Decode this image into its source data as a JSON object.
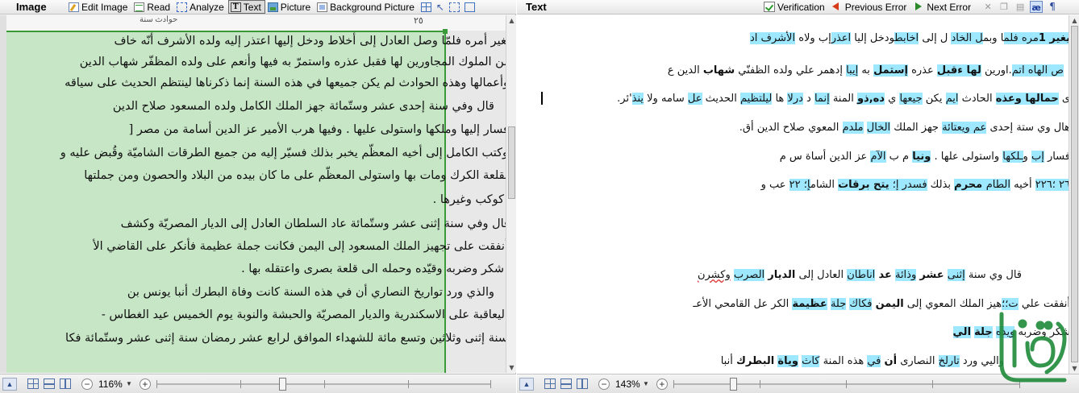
{
  "left_panel": {
    "title": "Image",
    "toolbar": {
      "edit_image": "Edit Image",
      "read": "Read",
      "analyze": "Analyze",
      "text": "Text",
      "picture": "Picture",
      "background_picture": "Background Picture"
    },
    "page_header_text": "حوادث سنة",
    "page_number": "٢٥",
    "lines": [
      "بغير أمره فلمّا وصل العادل إلى أخلاط ودخل إليها اعتذر إليه ولده الأشرف أنّه خاف",
      "من الملوك المجاورين لها فقبل عذره واستمرّ به فيها وأنعم على ولده المظفّر شهاب الدين",
      "وأعمالها وهذه الحوادث لم يكن جميعها في هذه السنة إنما ذكرناها لينتظم الحديث على سياقه",
      "قال وفي سنة إحدى عشر وستّمائة جهز الملك الكامل ولده المسعود صلاح الدين",
      "فسار إليها وملكها واستولى عليها . وفيها هرب الأمير عز الدين أسامة من مصر [",
      "وكتب الكامل إلى أخيه المعظّم يخبر بذلك فسيّر إليه من جميع الطرقات الشاميّة وقُبض عليه و",
      "بقلعة الكرك ومات بها واستولى المعظّم على ما كان بيده من البلاد والحصون ومن جملتها",
      "كوكب وغيرها .",
      "قال وفي سنة إثنى عشر وستّمائة عاد السلطان العادل إلى الديار المصريّة وكشف",
      "أنفقت على تجهيز الملك المسعود إلى اليمن فكانت جملة عظيمة فأنكر على القاضي الأ",
      "شكر وضربه وقيّده وحمله الى قلعة بصرى واعتقله بها .",
      "والذي ورد تواريخ النصاري أن في هذه السنة كانت وفاة البطرك أنبا يونس بن",
      "اليعاقبة على الاسكندرية والديار المصريّة والحبشة والنوبة يوم الخميس عيد الغطاس -",
      "سنة إثنى وثلاثين وتسع مائة للشهداء الموافق لرابع عشر رمضان سنة إثنى عشر وستّمائة فكا"
    ],
    "zoom": "116%"
  },
  "right_panel": {
    "title": "Text",
    "toolbar": {
      "verification": "Verification",
      "previous_error": "Previous Error",
      "next_error": "Next Error"
    },
    "zoom": "143%",
    "lines": [
      [
        {
          "t": "يغير ",
          "hl": true,
          "b": true
        },
        {
          "t": "1",
          "hl": true,
          "b": true
        },
        {
          "t": "مره ",
          "hl": true
        },
        {
          "t": "فلم",
          "hl": true
        },
        {
          "t": "ا وبم",
          "hl": false
        },
        {
          "t": "ل ",
          "hl": true
        },
        {
          "t": "الخاد",
          "hl": true
        },
        {
          "t": " ل إلى ",
          "hl": false
        },
        {
          "t": "اخابط",
          "hl": true
        },
        {
          "t": "ودخل إليا ",
          "hl": false
        },
        {
          "t": "اعذر",
          "hl": true
        },
        {
          "t": "إب ولاه ",
          "hl": false
        },
        {
          "t": "الأشرف اد",
          "hl": true
        }
      ],
      [
        {
          "t": "ص ",
          "hl": true
        },
        {
          "t": "الهاه",
          "hl": true
        },
        {
          "t": " اتم",
          "hl": true
        },
        {
          "t": ".اورين ",
          "hl": false
        },
        {
          "t": "لها ",
          "hl": true,
          "b": true
        },
        {
          "t": "ءقبل",
          "hl": true,
          "b": true
        },
        {
          "t": " عذره ",
          "hl": false
        },
        {
          "t": "إستمل",
          "hl": true,
          "b": true
        },
        {
          "t": " به ",
          "hl": false
        },
        {
          "t": "إيبا",
          "hl": true
        },
        {
          "t": " إدهمر علي ولده الظفنّي ",
          "hl": false
        },
        {
          "t": "شهاب",
          "hl": false,
          "b": true
        },
        {
          "t": " الدين ع",
          "hl": false
        }
      ],
      [
        {
          "t": "ى ",
          "hl": false
        },
        {
          "t": "حمالها",
          "hl": true,
          "b": true
        },
        {
          "t": " وعذه",
          "hl": true,
          "b": true
        },
        {
          "t": " الحادث ",
          "hl": false
        },
        {
          "t": "ايم",
          "hl": true
        },
        {
          "t": " يكن ",
          "hl": false
        },
        {
          "t": "جيعها",
          "hl": true
        },
        {
          "t": " ي ",
          "hl": false
        },
        {
          "t": "ده,ذو",
          "hl": true,
          "b": true
        },
        {
          "t": " المنة ",
          "hl": false
        },
        {
          "t": "إنما",
          "hl": true
        },
        {
          "t": " د ",
          "hl": false
        },
        {
          "t": "درلا",
          "hl": true
        },
        {
          "t": " ها ",
          "hl": false
        },
        {
          "t": "ليلت",
          "hl": true
        },
        {
          "t": "ظيم",
          "hl": true
        },
        {
          "t": " الحديث ",
          "hl": false
        },
        {
          "t": "عل",
          "hl": true
        },
        {
          "t": " سامه ولا ",
          "hl": false
        },
        {
          "t": "ينذ",
          "hl": true
        },
        {
          "t": "'ئر.",
          "hl": false
        }
      ],
      [
        {
          "t": "هال وي ستة إحدى ",
          "hl": false
        },
        {
          "t": "عم",
          "hl": true
        },
        {
          "t": " ويعتائة",
          "hl": true
        },
        {
          "t": " جهز الملك ",
          "hl": false
        },
        {
          "t": "الخال",
          "hl": true
        },
        {
          "t": " ",
          "hl": false
        },
        {
          "t": "ملدم",
          "hl": true
        },
        {
          "t": " المعوي صلاح الدين أق.",
          "hl": false
        }
      ],
      [
        {
          "t": "فسار ",
          "hl": false
        },
        {
          "t": "إب",
          "hl": true
        },
        {
          "t": " و",
          "hl": false
        },
        {
          "t": "ـلكها",
          "hl": true
        },
        {
          "t": " واستولى علها . ",
          "hl": false
        },
        {
          "t": "ونيا",
          "hl": true,
          "b": true
        },
        {
          "t": " م ب ",
          "hl": false
        },
        {
          "t": "الآم",
          "hl": true
        },
        {
          "t": " عز الدين أساة س م",
          "hl": false
        }
      ],
      [
        {
          "t": "٢٦ ",
          "hl": true
        },
        {
          "t": "؛٢٢٦",
          "hl": true
        },
        {
          "t": " أخيه ",
          "hl": false
        },
        {
          "t": "الطام",
          "hl": true
        },
        {
          "t": " محرم",
          "hl": true,
          "b": true
        },
        {
          "t": " بذلك ",
          "hl": false
        },
        {
          "t": "فسدر",
          "hl": true
        },
        {
          "t": " إ؛ ",
          "hl": true
        },
        {
          "t": "يتح",
          "hl": true,
          "b": true
        },
        {
          "t": " برقات",
          "hl": true,
          "b": true
        },
        {
          "t": " الشام",
          "hl": false
        },
        {
          "t": "إ؛ ",
          "hl": true
        },
        {
          "t": "٢٢",
          "hl": true
        },
        {
          "t": " عب و",
          "hl": false
        }
      ],
      [
        {
          "t": "قال وي سنة ",
          "hl": false
        },
        {
          "t": "إثنى",
          "hl": true
        },
        {
          "t": " ",
          "hl": false
        },
        {
          "t": "عشر",
          "hl": false,
          "b": true
        },
        {
          "t": " ",
          "hl": false
        },
        {
          "t": "وذائة",
          "hl": true
        },
        {
          "t": " ",
          "hl": false
        },
        {
          "t": "عد",
          "hl": false,
          "b": true
        },
        {
          "t": " ",
          "hl": false
        },
        {
          "t": "اناطان",
          "hl": true
        },
        {
          "t": " العادل إلى ",
          "hl": false
        },
        {
          "t": "الديار",
          "hl": false,
          "b": true
        },
        {
          "t": " ",
          "hl": false
        },
        {
          "t": "الصرب",
          "hl": true
        },
        {
          "t": " ",
          "hl": false
        },
        {
          "t": "وكشرن",
          "hl": false,
          "ul": true
        }
      ],
      [
        {
          "t": "أنفقت علي ",
          "hl": false
        },
        {
          "t": "ت؛؛",
          "hl": true
        },
        {
          "t": "هيز الملك المعوي إلى ",
          "hl": false
        },
        {
          "t": "اليمن",
          "hl": false,
          "b": true
        },
        {
          "t": " ",
          "hl": false
        },
        {
          "t": "فكاك",
          "hl": true
        },
        {
          "t": " ",
          "hl": false
        },
        {
          "t": "جلة",
          "hl": true
        },
        {
          "t": " ",
          "hl": false
        },
        {
          "t": "عظيمة",
          "hl": true,
          "b": true
        },
        {
          "t": " الكر عل القامحي الأعـ",
          "hl": false
        }
      ],
      [
        {
          "t": "شكر وضربه ",
          "hl": false
        },
        {
          "t": "ويده",
          "hl": true
        },
        {
          "t": " ",
          "hl": false
        },
        {
          "t": "جلة",
          "hl": true,
          "b": true
        },
        {
          "t": " ",
          "hl": false
        },
        {
          "t": "الي",
          "hl": true,
          "b": true
        }
      ],
      [
        {
          "t": "واليي ورد ",
          "hl": false
        },
        {
          "t": "تارلخ",
          "hl": true
        },
        {
          "t": " النصارى ",
          "hl": false
        },
        {
          "t": "أن",
          "hl": false,
          "b": true
        },
        {
          "t": " ",
          "hl": false
        },
        {
          "t": "في",
          "hl": true
        },
        {
          "t": " هذه المنة ",
          "hl": false
        },
        {
          "t": "كاث",
          "hl": true
        },
        {
          "t": " ",
          "hl": false
        },
        {
          "t": "وياة",
          "hl": true,
          "b": true
        },
        {
          "t": " ",
          "hl": false
        },
        {
          "t": "البطرك",
          "hl": false,
          "b": true
        },
        {
          "t": " أنبا",
          "hl": false
        }
      ]
    ]
  },
  "watermark_text": "التورى",
  "colors": {
    "highlight": "#9de7ff",
    "block_fill": "#c6e6c6",
    "block_border": "#3a9a3a"
  }
}
